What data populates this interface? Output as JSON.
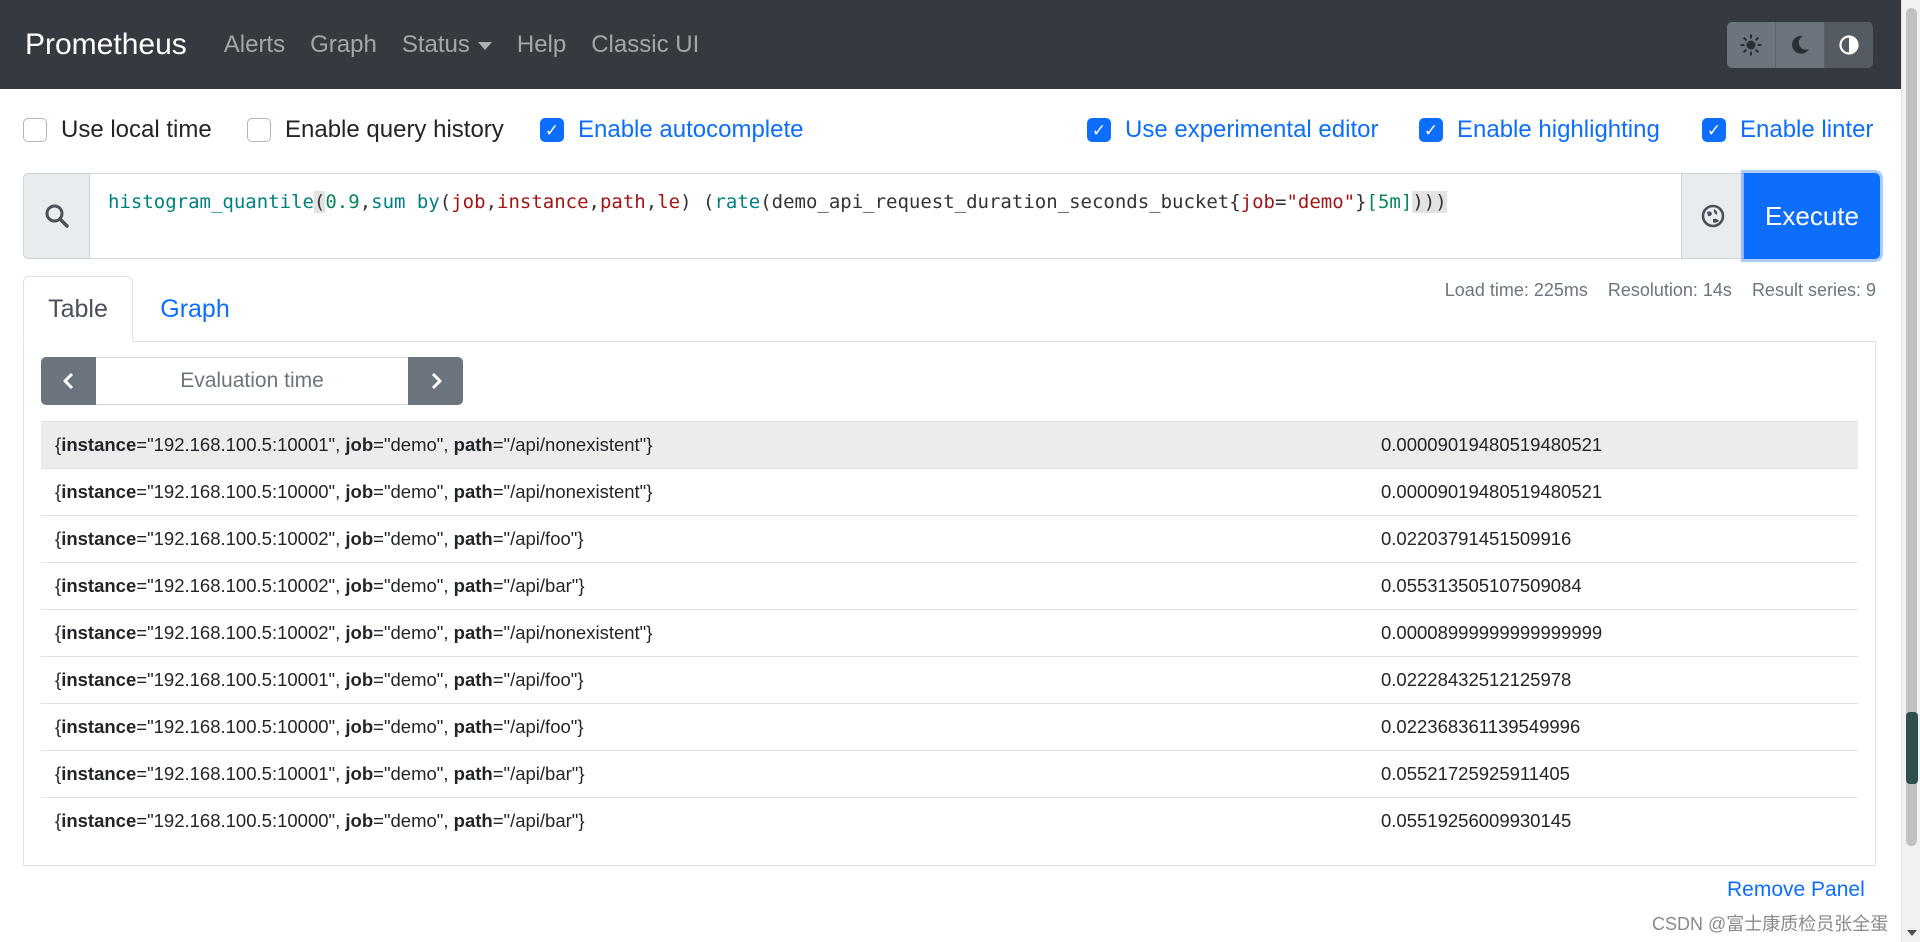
{
  "navbar": {
    "brand": "Prometheus",
    "links": [
      "Alerts",
      "Graph",
      "Status",
      "Help",
      "Classic UI"
    ],
    "theme_buttons": [
      "sun-icon",
      "moon-icon",
      "contrast-icon"
    ],
    "bg_color": "#343a40"
  },
  "options": {
    "use_local_time": {
      "label": "Use local time",
      "checked": false
    },
    "enable_query_history": {
      "label": "Enable query history",
      "checked": false
    },
    "enable_autocomplete": {
      "label": "Enable autocomplete",
      "checked": true
    },
    "use_experimental_editor": {
      "label": "Use experimental editor",
      "checked": true
    },
    "enable_highlighting": {
      "label": "Enable highlighting",
      "checked": true
    },
    "enable_linter": {
      "label": "Enable linter",
      "checked": true
    }
  },
  "expression": {
    "fn1": "histogram_quantile",
    "open1": "(",
    "num": "0.9",
    "comma1": ",",
    "agg": "sum by",
    "open2": "(",
    "l1": "job",
    "c2": ",",
    "l2": "instance",
    "c3": ",",
    "l3": "path",
    "c4": ",",
    "l4": "le",
    "close2": ") ",
    "open3": "(",
    "fn2": "rate",
    "open4": "(",
    "metric": "demo_api_request_duration_seconds_bucket",
    "brace_open": "{",
    "sel_label": "job",
    "eq": "=",
    "sel_value": "\"demo\"",
    "brace_close": "}",
    "range": "[5m]",
    "close_all": ")))"
  },
  "execute_label": "Execute",
  "stats": {
    "load_time": "Load time: 225ms",
    "resolution": "Resolution: 14s",
    "result_series": "Result series: 9"
  },
  "tabs": {
    "table": "Table",
    "graph": "Graph"
  },
  "eval_time_placeholder": "Evaluation time",
  "results": [
    {
      "instance": "\"192.168.100.5:10001\"",
      "job": "\"demo\"",
      "path": "\"/api/nonexistent\"",
      "value": "0.00009019480519480521"
    },
    {
      "instance": "\"192.168.100.5:10000\"",
      "job": "\"demo\"",
      "path": "\"/api/nonexistent\"",
      "value": "0.00009019480519480521"
    },
    {
      "instance": "\"192.168.100.5:10002\"",
      "job": "\"demo\"",
      "path": "\"/api/foo\"",
      "value": "0.02203791451509916"
    },
    {
      "instance": "\"192.168.100.5:10002\"",
      "job": "\"demo\"",
      "path": "\"/api/bar\"",
      "value": "0.055313505107509084"
    },
    {
      "instance": "\"192.168.100.5:10002\"",
      "job": "\"demo\"",
      "path": "\"/api/nonexistent\"",
      "value": "0.00008999999999999999"
    },
    {
      "instance": "\"192.168.100.5:10001\"",
      "job": "\"demo\"",
      "path": "\"/api/foo\"",
      "value": "0.02228432512125978"
    },
    {
      "instance": "\"192.168.100.5:10000\"",
      "job": "\"demo\"",
      "path": "\"/api/foo\"",
      "value": "0.022368361139549996"
    },
    {
      "instance": "\"192.168.100.5:10001\"",
      "job": "\"demo\"",
      "path": "\"/api/bar\"",
      "value": "0.05521725925911405"
    },
    {
      "instance": "\"192.168.100.5:10000\"",
      "job": "\"demo\"",
      "path": "\"/api/bar\"",
      "value": "0.05519256009930145"
    }
  ],
  "label_keys": {
    "instance": "instance",
    "job": "job",
    "path": "path"
  },
  "remove_panel": "Remove Panel",
  "watermark": "CSDN @富士康质检员张全蛋",
  "accent_color": "#0d6efd"
}
